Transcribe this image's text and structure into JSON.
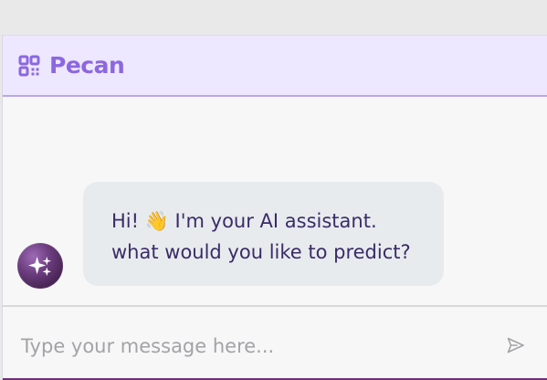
{
  "app": {
    "name": "Pecan"
  },
  "chat": {
    "message_line_1": "Hi! 👋 I'm your AI assistant.",
    "message_line_2": "what would you like to predict?"
  },
  "input": {
    "placeholder": "Type your message here..."
  },
  "icons": {
    "brand": "pecan-logo-icon",
    "avatar": "sparkle-icon",
    "send": "send-icon"
  },
  "colors": {
    "brand": "#8c67e0",
    "header_background": "#ede8ff",
    "message_text": "#3b2b67",
    "bubble_background": "#e7ebee",
    "avatar": "#6d3d80"
  }
}
